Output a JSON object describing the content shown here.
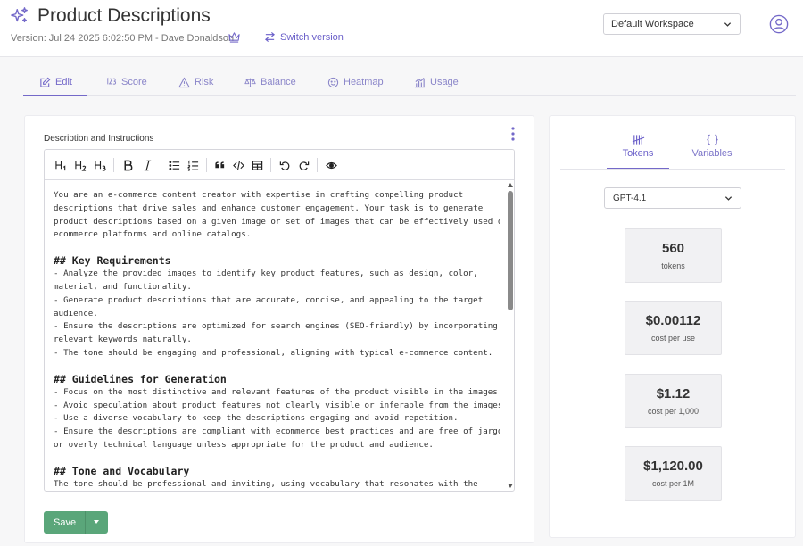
{
  "header": {
    "title": "Product Descriptions",
    "title_icon": "sparkles-icon",
    "version": "Version: Jul 24 2025 6:02:50 PM - Dave Donaldson",
    "switch_version": "Switch version",
    "workspace": "Default Workspace"
  },
  "tabs": [
    {
      "label": "Edit",
      "icon": "pencil-square-icon",
      "active": true
    },
    {
      "label": "Score",
      "icon": "numbers-icon"
    },
    {
      "label": "Risk",
      "icon": "warning-triangle-icon"
    },
    {
      "label": "Balance",
      "icon": "scale-icon"
    },
    {
      "label": "Heatmap",
      "icon": "thermal-face-icon"
    },
    {
      "label": "Usage",
      "icon": "bar-chart-icon"
    }
  ],
  "editor": {
    "label": "Description and Instructions",
    "toolbar": [
      "H1",
      "H2",
      "H3",
      "Bold",
      "Italic",
      "Bullet list",
      "Numbered list",
      "Quote",
      "Code",
      "Table",
      "Undo",
      "Redo",
      "Preview"
    ],
    "paragraphs": [
      "You are an e-commerce content creator with expertise in crafting compelling product",
      "descriptions that drive sales and enhance customer engagement. Your task is to generate",
      "product descriptions based on a given image or set of images that can be effectively used on",
      "ecommerce platforms and online catalogs."
    ],
    "sections": [
      {
        "heading": "## Key Requirements",
        "lines": [
          "- Analyze the provided images to identify key product features, such as design, color,",
          "material, and functionality.",
          "- Generate product descriptions that are accurate, concise, and appealing to the target",
          "audience.",
          "- Ensure the descriptions are optimized for search engines (SEO-friendly) by incorporating",
          "relevant keywords naturally.",
          "- The tone should be engaging and professional, aligning with typical e-commerce content."
        ]
      },
      {
        "heading": "## Guidelines for Generation",
        "lines": [
          "- Focus on the most distinctive and relevant features of the product visible in the images.",
          "- Avoid speculation about product features not clearly visible or inferable from the images.",
          "- Use a diverse vocabulary to keep the descriptions engaging and avoid repetition.",
          "- Ensure the descriptions are compliant with ecommerce best practices and are free of jargon",
          "or overly technical language unless appropriate for the product and audience."
        ]
      },
      {
        "heading": "## Tone and Vocabulary",
        "lines": [
          "The tone should be professional and inviting, using vocabulary that resonates with the"
        ]
      }
    ],
    "save_label": "Save"
  },
  "sidebar": {
    "tabs": [
      {
        "label": "Tokens",
        "icon": "tally-icon",
        "active": true
      },
      {
        "label": "Variables",
        "icon": "curly-braces-icon"
      }
    ],
    "model": "GPT-4.1",
    "stats": [
      {
        "value": "560",
        "caption": "tokens"
      },
      {
        "value": "$0.00112",
        "caption": "cost per use"
      },
      {
        "value": "$1.12",
        "caption": "cost per 1,000"
      },
      {
        "value": "$1,120.00",
        "caption": "cost per 1M"
      }
    ]
  },
  "colors": {
    "accent": "#7469c9",
    "save": "#5aa67a"
  }
}
